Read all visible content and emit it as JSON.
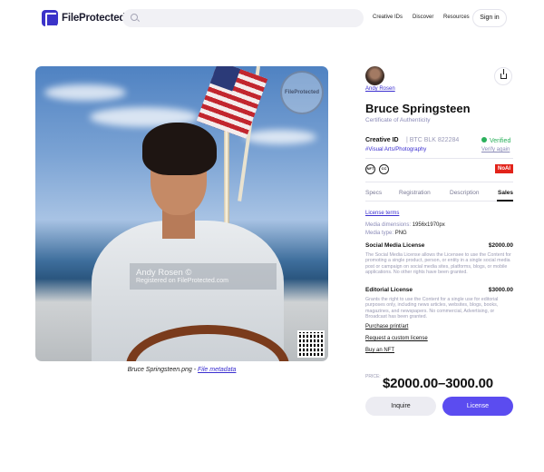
{
  "header": {
    "brand": "FileProtected",
    "search_placeholder": "",
    "nav": [
      "Creative IDs",
      "Discover",
      "Resources"
    ],
    "signin": "Sign in"
  },
  "image": {
    "watermark_title": "Andy Rosen ©",
    "watermark_sub": "Registered on FileProtected.com",
    "stamp": "FileProtected",
    "caption_file": "Bruce Springsteen.png",
    "caption_sep": " - ",
    "caption_link": "File metadata"
  },
  "artwork": {
    "author": "Andy Rosen",
    "title": "Bruce Springsteen",
    "subtitle": "Certificate of Authenticity",
    "creative_id_label": "Creative ID",
    "creative_id_value": "| BTC BLK 822284",
    "verified": "Verified",
    "tag": "#Visual Arts/Photography",
    "verify_again": "Verify again",
    "license_icons": [
      "NFT",
      "CC"
    ],
    "noai": "NoAI"
  },
  "tabs": [
    {
      "label": "Specs",
      "active": false
    },
    {
      "label": "Registration",
      "active": false
    },
    {
      "label": "Description",
      "active": false
    },
    {
      "label": "Sales",
      "active": true
    }
  ],
  "sales": {
    "license_terms": "License terms",
    "media_dimensions_label": "Media dimensions:",
    "media_dimensions_value": "1956x1970px",
    "media_type_label": "Media type:",
    "media_type_value": "PNG",
    "licenses": [
      {
        "name": "Social Media License",
        "price": "$2000.00",
        "description": "The Social Media License allows the Licensee to use the Content for promoting a single product, person, or entity in a single social media post or campaign on social media sites, platforms, blogs, or mobile applications. No other rights have been granted."
      },
      {
        "name": "Editorial License",
        "price": "$3000.00",
        "description": "Grants the right to use the Content for a single use for editorial purposes only, including news articles, websites, blogs, books, magazines, and newspapers. No commercial, Advertising, or Broadcast has been granted."
      }
    ],
    "actions": [
      "Purchase print/art",
      "Request a custom license",
      "Buy an NFT"
    ],
    "price_label": "PRICE:",
    "price": "$2000.00–3000.00",
    "inquire": "Inquire",
    "license_button": "License"
  },
  "colors": {
    "accent": "#5b4cf0",
    "link": "#3b2fd0",
    "verified": "#2bb05c",
    "noai": "#e2231a"
  }
}
